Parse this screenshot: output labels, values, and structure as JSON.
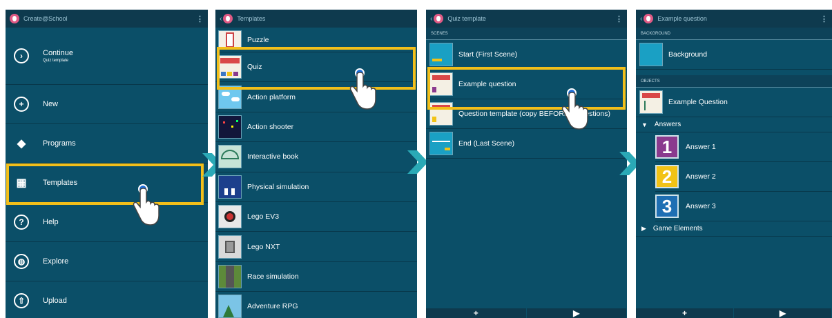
{
  "screen1": {
    "title": "Create@School",
    "continue_label": "Continue",
    "continue_sub": "Quiz template",
    "items": [
      {
        "label": "New"
      },
      {
        "label": "Programs"
      },
      {
        "label": "Templates"
      },
      {
        "label": "Help"
      },
      {
        "label": "Explore"
      },
      {
        "label": "Upload"
      }
    ]
  },
  "screen2": {
    "title": "Templates",
    "items": [
      {
        "label": "Puzzle"
      },
      {
        "label": "Quiz"
      },
      {
        "label": "Action platform"
      },
      {
        "label": "Action shooter"
      },
      {
        "label": "Interactive book"
      },
      {
        "label": "Physical simulation"
      },
      {
        "label": "Lego EV3"
      },
      {
        "label": "Lego NXT"
      },
      {
        "label": "Race simulation"
      },
      {
        "label": "Adventure RPG"
      }
    ]
  },
  "screen3": {
    "title": "Quiz template",
    "section": "SCENES",
    "scenes": [
      {
        "label": "Start (First Scene)"
      },
      {
        "label": "Example question"
      },
      {
        "label": "Question template (copy BEFORE g questions)"
      },
      {
        "label": "End (Last Scene)"
      }
    ],
    "bottom_add": "+",
    "bottom_play": "▶"
  },
  "screen4": {
    "title": "Example question",
    "background_header": "BACKGROUND",
    "background_label": "Background",
    "objects_header": "OBJECTS",
    "object_label": "Example Question",
    "answers_group": "Answers",
    "answers": [
      {
        "num": "1",
        "label": "Answer 1",
        "color": "#8a3a8e"
      },
      {
        "num": "2",
        "label": "Answer 2",
        "color": "#f2c316"
      },
      {
        "num": "3",
        "label": "Answer 3",
        "color": "#1e6fb3"
      }
    ],
    "game_elements": "Game Elements",
    "bottom_add": "+",
    "bottom_play": "▶"
  },
  "colors": {
    "highlight": "#f2bf1a",
    "arrow": "#2aa9b6",
    "panel": "#0b4f68"
  }
}
